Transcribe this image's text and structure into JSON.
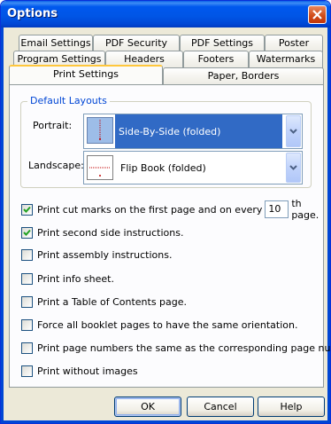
{
  "window": {
    "title": "Options"
  },
  "tabs": {
    "row1": [
      "Email Settings",
      "PDF Security",
      "PDF Settings",
      "Poster"
    ],
    "row2": [
      "Program Settings",
      "Headers",
      "Footers",
      "Watermarks"
    ],
    "row3": [
      "Print Settings",
      "Paper, Borders"
    ],
    "active": "Print Settings"
  },
  "default_layouts": {
    "group_title": "Default Layouts",
    "portrait_label": "Portrait:",
    "portrait_value": "Side-By-Side (folded)",
    "landscape_label": "Landscape:",
    "landscape_value": "Flip Book (folded)"
  },
  "options": {
    "cut_marks_prefix": "Print cut marks on the first page and on every",
    "cut_marks_value": "10",
    "cut_marks_suffix": "th page.",
    "second_side": "Print second side instructions.",
    "assembly": "Print assembly instructions.",
    "info_sheet": "Print info sheet.",
    "toc": "Print a Table of Contents page.",
    "orientation": "Force all booklet pages to have the same orientation.",
    "page_numbers": "Print page numbers the same as the corresponding page number.",
    "without_images": "Print without images"
  },
  "checked": {
    "cut_marks": true,
    "second_side": true,
    "assembly": false,
    "info_sheet": false,
    "toc": false,
    "orientation": false,
    "page_numbers": false,
    "without_images": false
  },
  "buttons": {
    "ok": "OK",
    "cancel": "Cancel",
    "help": "Help"
  },
  "colors": {
    "title_bar": "#0055e5",
    "selection": "#316ac5",
    "group_title": "#0046d5",
    "active_tab_accent": "#ffc73c"
  },
  "icons": {
    "close": "close-icon",
    "dropdown": "chevron-down-icon",
    "check": "check-icon"
  }
}
